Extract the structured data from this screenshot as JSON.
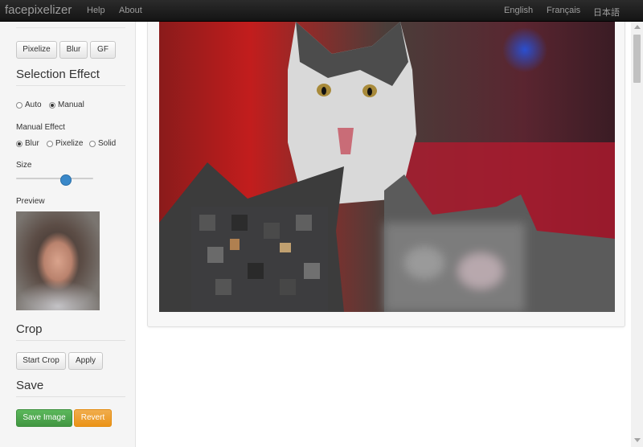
{
  "navbar": {
    "brand": "facepixelizer",
    "links": [
      "Help",
      "About"
    ],
    "languages": [
      "English",
      "Français",
      "日本語"
    ]
  },
  "sidebar": {
    "mode_buttons": [
      "Pixelize",
      "Blur",
      "GF"
    ],
    "selection_effect": {
      "heading": "Selection Effect",
      "modes": [
        {
          "label": "Auto",
          "checked": false
        },
        {
          "label": "Manual",
          "checked": true
        }
      ],
      "manual_effect_label": "Manual Effect",
      "effects": [
        {
          "label": "Blur",
          "checked": true
        },
        {
          "label": "Pixelize",
          "checked": false
        },
        {
          "label": "Solid",
          "checked": false
        }
      ],
      "size_label": "Size",
      "size_value": 0.62,
      "preview_label": "Preview"
    },
    "crop": {
      "heading": "Crop",
      "start_button": "Start Crop",
      "apply_button": "Apply"
    },
    "save": {
      "heading": "Save",
      "save_button": "Save Image",
      "revert_button": "Revert"
    }
  },
  "colors": {
    "success": "#5cb85c",
    "warning": "#f0ad4e",
    "slider_accent": "#3a88c9"
  }
}
